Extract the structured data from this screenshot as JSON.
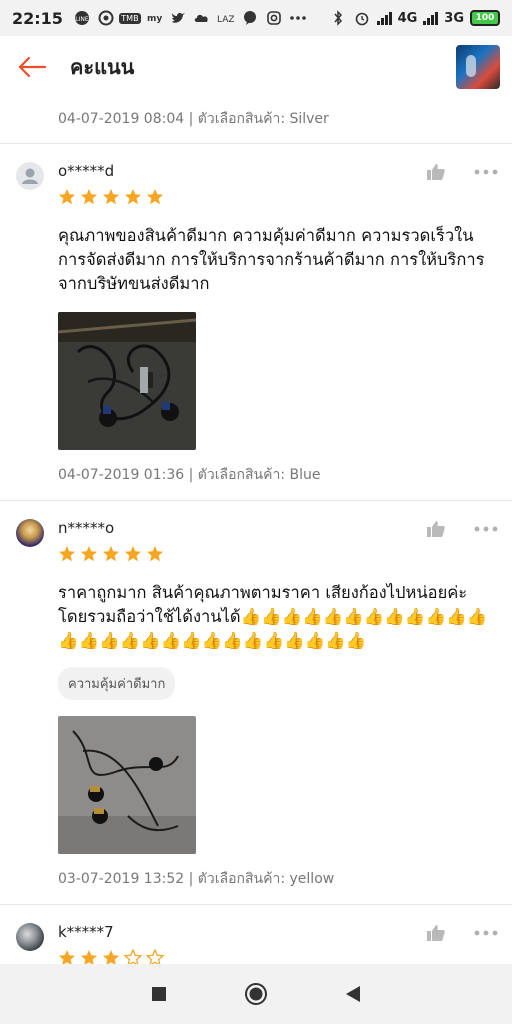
{
  "status_bar": {
    "time": "22:15",
    "left_icons": [
      "line-icon",
      "target-icon",
      "tmb-icon",
      "my-icon",
      "twitter-icon",
      "cloud-icon",
      "laz-icon",
      "chat-icon",
      "instagram-icon",
      "more-dots-icon"
    ],
    "network_1": "4G",
    "network_2": "3G",
    "battery": "100"
  },
  "header": {
    "title": "คะแนน"
  },
  "reviews": [
    {
      "tail_meta": "04-07-2019 08:04 | ตัวเลือกสินค้า: Silver"
    },
    {
      "username": "o*****d",
      "rating": 5,
      "text": "คุณภาพของสินค้าดีมาก ความคุ้มค่าดีมาก ความรวดเร็วในการจัดส่งดีมาก การให้บริการจากร้านค้าดีมาก การให้บริการจากบริษัทขนส่งดีมาก",
      "date": "04-07-2019 01:36",
      "variant_label": "ตัวเลือกสินค้า:",
      "variant": "Blue"
    },
    {
      "username": "n*****o",
      "rating": 5,
      "text": "ราคาถูกมาก สินค้าคุณภาพตามราคา เสียงก้องไปหน่อยค่ะ โดยรวมถือว่าใช้ได้งานได้👍👍👍👍👍👍👍👍👍👍👍👍👍👍👍👍👍👍👍👍👍👍👍👍👍👍👍",
      "tag": "ความคุ้มค่าดีมาก",
      "date": "03-07-2019 13:52",
      "variant_label": "ตัวเลือกสินค้า:",
      "variant": "yellow"
    },
    {
      "username": "k*****7",
      "rating": 3
    }
  ],
  "colors": {
    "accent": "#ee4d2d",
    "star": "#f6a623",
    "star_empty": "#f6a623"
  }
}
